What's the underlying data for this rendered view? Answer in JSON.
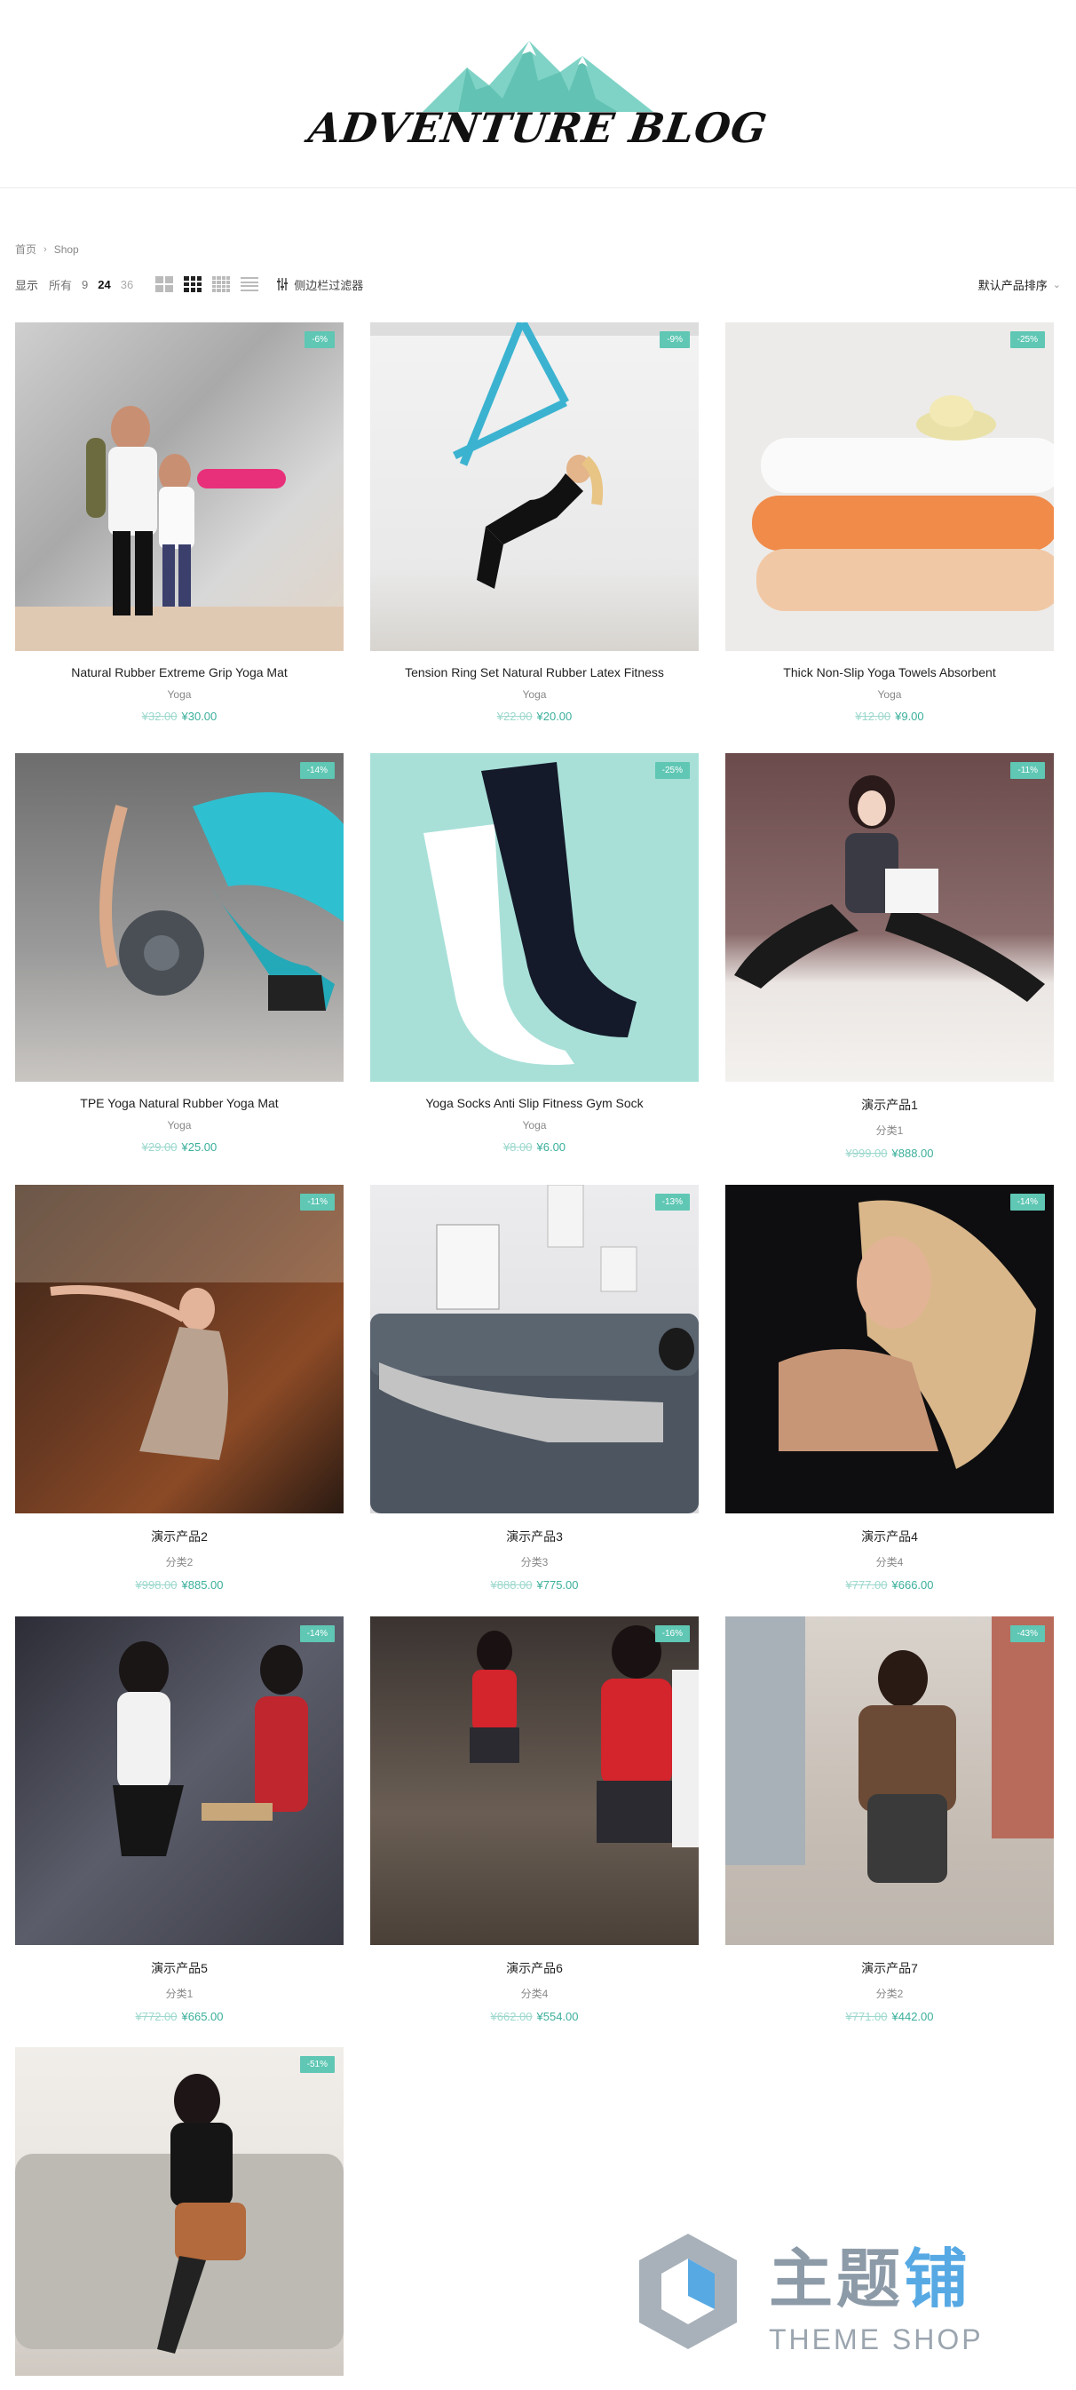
{
  "site": {
    "logo_text": "ADVENTURE BLOG"
  },
  "breadcrumb": {
    "home": "首页",
    "current": "Shop"
  },
  "toolbar": {
    "show_label": "显示",
    "all": "所有",
    "n9": "9",
    "n24": "24",
    "n36": "36",
    "filter_label": "侧边栏过滤器",
    "sort_label": "默认产品排序"
  },
  "colors": {
    "accent": "#5fc7b4",
    "price": "#3aaf9b"
  },
  "products": [
    {
      "name": "Natural Rubber Extreme Grip Yoga Mat",
      "cat": "Yoga",
      "old": "¥32.00",
      "new": "¥30.00",
      "badge": "-6%"
    },
    {
      "name": "Tension Ring Set Natural Rubber Latex Fitness",
      "cat": "Yoga",
      "old": "¥22.00",
      "new": "¥20.00",
      "badge": "-9%"
    },
    {
      "name": "Thick Non-Slip Yoga Towels Absorbent",
      "cat": "Yoga",
      "old": "¥12.00",
      "new": "¥9.00",
      "badge": "-25%"
    },
    {
      "name": "TPE Yoga Natural Rubber Yoga Mat",
      "cat": "Yoga",
      "old": "¥29.00",
      "new": "¥25.00",
      "badge": "-14%"
    },
    {
      "name": "Yoga Socks Anti Slip Fitness Gym Sock",
      "cat": "Yoga",
      "old": "¥8.00",
      "new": "¥6.00",
      "badge": "-25%"
    },
    {
      "name": "演示产品1",
      "cat": "分类1",
      "old": "¥999.00",
      "new": "¥888.00",
      "badge": "-11%"
    },
    {
      "name": "演示产品2",
      "cat": "分类2",
      "old": "¥998.00",
      "new": "¥885.00",
      "badge": "-11%"
    },
    {
      "name": "演示产品3",
      "cat": "分类3",
      "old": "¥888.00",
      "new": "¥775.00",
      "badge": "-13%"
    },
    {
      "name": "演示产品4",
      "cat": "分类4",
      "old": "¥777.00",
      "new": "¥666.00",
      "badge": "-14%"
    },
    {
      "name": "演示产品5",
      "cat": "分类1",
      "old": "¥772.00",
      "new": "¥665.00",
      "badge": "-14%"
    },
    {
      "name": "演示产品6",
      "cat": "分类4",
      "old": "¥662.00",
      "new": "¥554.00",
      "badge": "-16%"
    },
    {
      "name": "演示产品7",
      "cat": "分类2",
      "old": "¥771.00",
      "new": "¥442.00",
      "badge": "-43%"
    },
    {
      "name": "",
      "cat": "",
      "old": "",
      "new": "",
      "badge": "-51%"
    }
  ],
  "watermark": {
    "cn_part1": "主题",
    "cn_part2": "铺",
    "en": "THEME SHOP"
  }
}
